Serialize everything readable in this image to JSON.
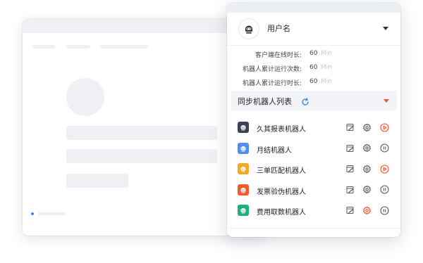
{
  "user": {
    "name": "用户名",
    "avatar_icon": "robot-avatar-icon"
  },
  "stats": [
    {
      "label": "客户端在线时长:",
      "value": "60",
      "unit": "Min"
    },
    {
      "label": "机器人累计运行次数:",
      "value": "60",
      "unit": "Min"
    },
    {
      "label": "机器人累计运行时长:",
      "value": "60",
      "unit": "Min"
    }
  ],
  "sync": {
    "title": "同步机器人列表",
    "refresh_icon": "refresh-icon",
    "accent": "#f0552c"
  },
  "robots": [
    {
      "name": "久其报表机器人",
      "color": "#3b4256",
      "status": "play",
      "gear_highlight": false
    },
    {
      "name": "月结机器人",
      "color": "#4e8ef7",
      "status": "pause",
      "gear_highlight": false
    },
    {
      "name": "三单匹配机器人",
      "color": "#f5a623",
      "status": "play",
      "gear_highlight": false
    },
    {
      "name": "发票验伪机器人",
      "color": "#f05a2d",
      "status": "pause",
      "gear_highlight": false
    },
    {
      "name": "费用取数机器人",
      "color": "#19b27a",
      "status": "pause",
      "gear_highlight": true
    }
  ],
  "colors": {
    "accent_orange": "#f0552c",
    "refresh_blue": "#3b82f6",
    "icon_gray": "#555b66"
  }
}
